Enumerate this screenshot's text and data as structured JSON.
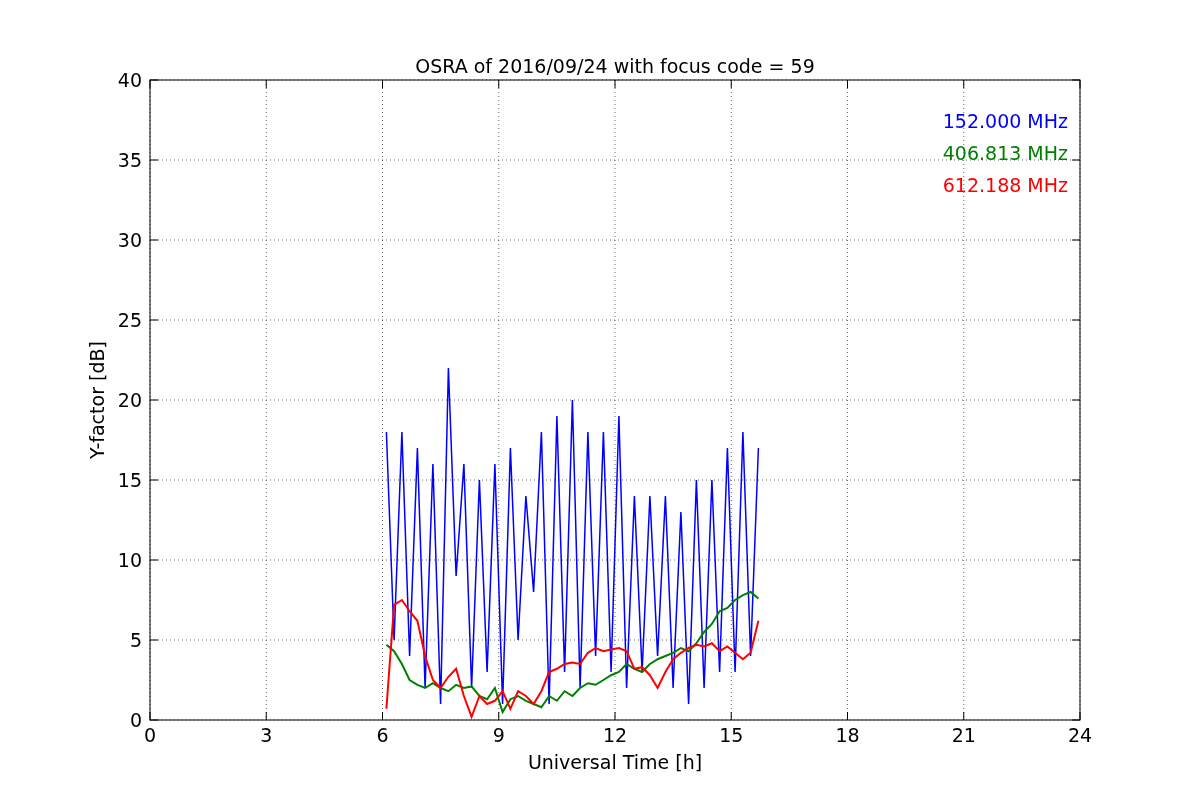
{
  "figure": {
    "chart_data": {
      "type": "line",
      "title": "OSRA of 2016/09/24 with focus code = 59",
      "xlabel": "Universal Time [h]",
      "ylabel": "Y-factor [dB]",
      "x": [
        6.1,
        6.3,
        6.5,
        6.7,
        6.9,
        7.1,
        7.3,
        7.5,
        7.7,
        7.9,
        8.1,
        8.3,
        8.5,
        8.7,
        8.9,
        9.1,
        9.3,
        9.5,
        9.7,
        9.9,
        10.1,
        10.3,
        10.5,
        10.7,
        10.9,
        11.1,
        11.3,
        11.5,
        11.7,
        11.9,
        12.1,
        12.3,
        12.5,
        12.7,
        12.9,
        13.1,
        13.3,
        13.5,
        13.7,
        13.9,
        14.1,
        14.3,
        14.5,
        14.7,
        14.9,
        15.1,
        15.3,
        15.5,
        15.7
      ],
      "series": [
        {
          "name": "152.000 MHz",
          "color": "#0000ff",
          "values": [
            18,
            5,
            18,
            4,
            17,
            2,
            16,
            1,
            22,
            9,
            16,
            2,
            15,
            3,
            16,
            1,
            17,
            5,
            14,
            8,
            18,
            1,
            19,
            3,
            20,
            2,
            18,
            4,
            18,
            3,
            19,
            2,
            14,
            3,
            14,
            4,
            14,
            2,
            13,
            1,
            15,
            2,
            15,
            3,
            17,
            3,
            18,
            4,
            17
          ]
        },
        {
          "name": "406.813 MHz",
          "color": "#008000",
          "values": [
            4.7,
            4.3,
            3.5,
            2.5,
            2.2,
            2.0,
            2.3,
            2.0,
            1.8,
            2.2,
            2.0,
            2.1,
            1.5,
            1.3,
            2.0,
            0.5,
            1.3,
            1.5,
            1.2,
            1.0,
            0.8,
            1.5,
            1.2,
            1.8,
            1.5,
            2.0,
            2.3,
            2.2,
            2.5,
            2.8,
            3.0,
            3.5,
            3.2,
            3.0,
            3.5,
            3.8,
            4.0,
            4.2,
            4.5,
            4.3,
            4.8,
            5.5,
            6.0,
            6.8,
            7.0,
            7.5,
            7.8,
            8.0,
            7.6
          ]
        },
        {
          "name": "612.188 MHz",
          "color": "#ff0000",
          "values": [
            0.7,
            7.2,
            7.5,
            6.8,
            6.2,
            4.0,
            2.5,
            2.0,
            2.7,
            3.2,
            1.5,
            0.2,
            1.5,
            1.0,
            1.2,
            1.8,
            0.7,
            1.8,
            1.5,
            1.0,
            1.8,
            3.0,
            3.2,
            3.5,
            3.6,
            3.5,
            4.2,
            4.5,
            4.3,
            4.4,
            4.5,
            4.3,
            3.2,
            3.3,
            2.8,
            2.0,
            3.0,
            3.8,
            4.2,
            4.5,
            4.7,
            4.6,
            4.8,
            4.3,
            4.6,
            4.2,
            3.8,
            4.2,
            6.2
          ]
        }
      ],
      "grid": true,
      "xlim": [
        0,
        24
      ],
      "ylim": [
        0,
        40
      ],
      "xticks": [
        0,
        3,
        6,
        9,
        12,
        15,
        18,
        21,
        24
      ],
      "yticks": [
        0,
        5,
        10,
        15,
        20,
        25,
        30,
        35,
        40
      ]
    }
  }
}
